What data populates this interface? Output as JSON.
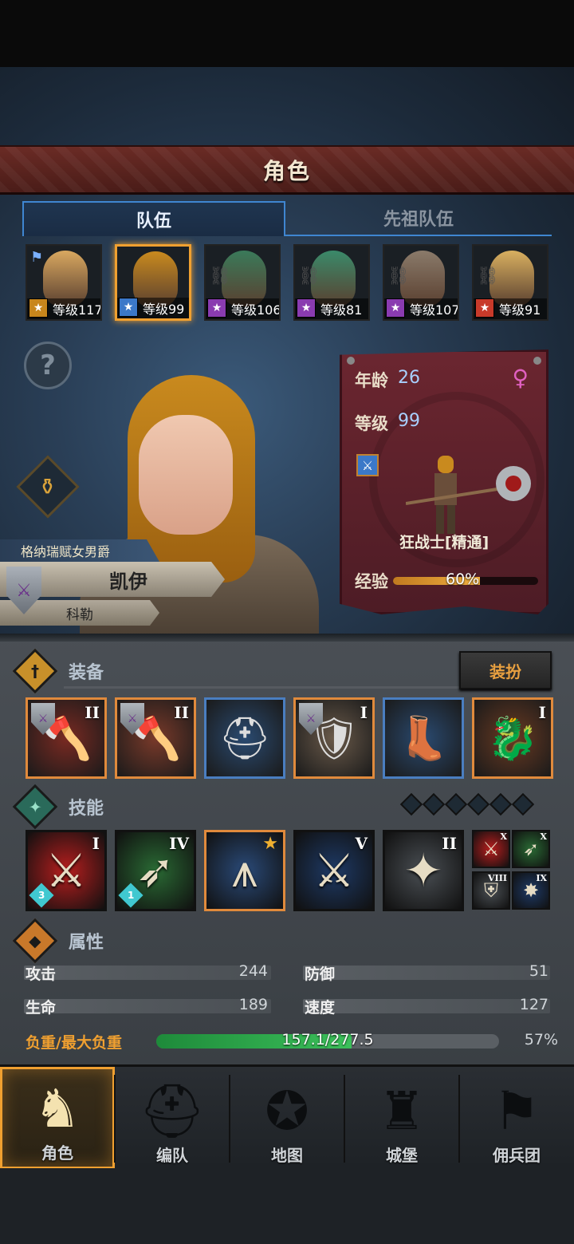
{
  "header": {
    "title": "角色"
  },
  "tabs": [
    {
      "label": "队伍",
      "active": true
    },
    {
      "label": "先祖队伍",
      "active": false
    }
  ],
  "party": [
    {
      "level": "等级117",
      "class_icon": "shield-class-icon",
      "class_color": "#c8861c",
      "face_color": "#d9a860",
      "flag": true,
      "selected": false
    },
    {
      "level": "等级99",
      "class_icon": "sword-class-icon",
      "class_color": "#3b78c8",
      "face_color": "#c98a1e",
      "selected": true
    },
    {
      "level": "等级106",
      "class_icon": "staff-class-icon",
      "class_color": "#8a3bb0",
      "face_color": "#3a7a5a",
      "locked": true,
      "selected": false
    },
    {
      "level": "等级81",
      "class_icon": "staff-class-icon",
      "class_color": "#8a3bb0",
      "face_color": "#3a8a6a",
      "locked": true,
      "selected": false
    },
    {
      "level": "等级107",
      "class_icon": "staff-class-icon",
      "class_color": "#8a3bb0",
      "face_color": "#8a7a6a",
      "locked": true,
      "selected": false
    },
    {
      "level": "等级91",
      "class_icon": "beast-class-icon",
      "class_color": "#c83a2a",
      "face_color": "#d9b060",
      "locked": true,
      "selected": false
    }
  ],
  "hero": {
    "title": "格纳瑞赋女男爵",
    "name": "凯伊",
    "origin": "科勒"
  },
  "info": {
    "age_label": "年龄",
    "age": "26",
    "level_label": "等级",
    "level": "99",
    "class_name": "狂战士[精通]",
    "xp_label": "经验",
    "xp_percent": 60,
    "xp_text": "60%"
  },
  "equipment": {
    "title": "装备",
    "dress_button": "装扮",
    "slots": [
      {
        "name": "weapon-1",
        "roman": "II",
        "shield": true,
        "border": "orange",
        "bg": "#7a2a22"
      },
      {
        "name": "weapon-2",
        "roman": "II",
        "shield": true,
        "border": "orange",
        "bg": "#7a3a2a"
      },
      {
        "name": "helmet",
        "roman": "",
        "shield": false,
        "border": "blue",
        "bg": "#2a4a70"
      },
      {
        "name": "armor",
        "roman": "I",
        "shield": true,
        "border": "orange",
        "bg": "#6a5a4a"
      },
      {
        "name": "boots",
        "roman": "",
        "shield": false,
        "border": "blue",
        "bg": "#2a4a70"
      },
      {
        "name": "trinket",
        "roman": "I",
        "shield": false,
        "border": "orange",
        "bg": "#6a3a22"
      }
    ]
  },
  "skills": {
    "title": "技能",
    "items": [
      {
        "roman": "I",
        "gem": "3",
        "bg": "#b81e1e",
        "glyph": "⚔"
      },
      {
        "roman": "IV",
        "gem": "1",
        "bg": "#2a6a34",
        "glyph": "➶"
      },
      {
        "roman": "",
        "star": true,
        "bg": "#2a4a78",
        "glyph": "⩚"
      },
      {
        "roman": "V",
        "bg": "#1e3a66",
        "glyph": "⚔"
      },
      {
        "roman": "II",
        "bg": "#4a4f54",
        "glyph": "✦"
      }
    ],
    "mini": [
      {
        "roman": "X",
        "bg": "#b81e1e",
        "glyph": "⚔"
      },
      {
        "roman": "X",
        "bg": "#2a6a34",
        "glyph": "➶"
      },
      {
        "roman": "VIII",
        "bg": "#4a4f54",
        "glyph": "⛨"
      },
      {
        "roman": "IX",
        "bg": "#1e3a66",
        "glyph": "✸"
      }
    ]
  },
  "attributes": {
    "title": "属性",
    "attack_label": "攻击",
    "attack": "244",
    "defense_label": "防御",
    "defense": "51",
    "life_label": "生命",
    "life": "189",
    "speed_label": "速度",
    "speed": "127",
    "load_label": "负重/最大负重",
    "load_text": "157.1/277.5",
    "load_percent": 57,
    "load_percent_text": "57%"
  },
  "nav": [
    {
      "label": "角色",
      "icon": "knight-icon",
      "glyph": "♞",
      "active": true
    },
    {
      "label": "编队",
      "icon": "helmet-icon",
      "glyph": "⛑",
      "active": false
    },
    {
      "label": "地图",
      "icon": "compass-map-icon",
      "glyph": "✪",
      "active": false
    },
    {
      "label": "城堡",
      "icon": "castle-icon",
      "glyph": "♜",
      "active": false
    },
    {
      "label": "佣兵团",
      "icon": "banner-icon",
      "glyph": "⚑",
      "active": false
    }
  ],
  "colors": {
    "accent": "#f0a030",
    "tab_blue": "#3f86d1",
    "panel_red": "#6b2630"
  }
}
